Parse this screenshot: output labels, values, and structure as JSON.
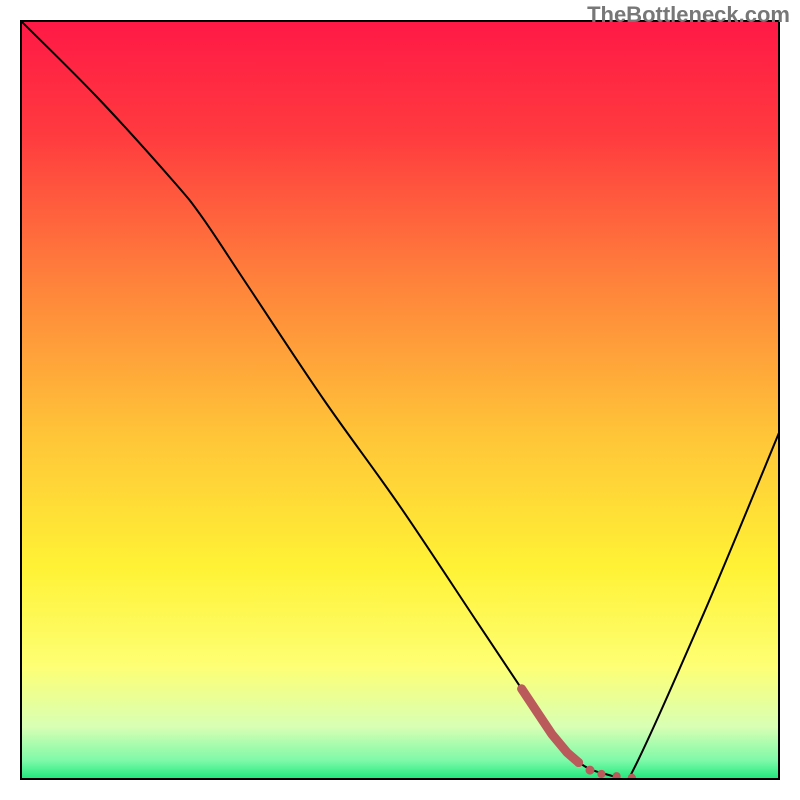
{
  "watermark": "TheBottleneck.com",
  "chart_data": {
    "type": "line",
    "title": "",
    "xlabel": "",
    "ylabel": "",
    "xlim": [
      0,
      100
    ],
    "ylim": [
      0,
      100
    ],
    "grid": false,
    "series": [
      {
        "name": "bottleneck-curve",
        "x": [
          0,
          10,
          20,
          24,
          30,
          40,
          50,
          60,
          66,
          70,
          74,
          78,
          80,
          90,
          100
        ],
        "y": [
          100,
          90,
          79,
          74,
          65,
          50,
          36,
          21,
          12,
          6,
          2,
          0.5,
          0,
          22,
          46
        ],
        "color": "#000000",
        "stroke_width": 2
      }
    ],
    "highlight_segment": {
      "name": "dotted-highlight",
      "color": "#bb5a5a",
      "stroke_width": 9,
      "points_x": [
        66,
        68,
        70,
        72,
        73.5,
        75,
        76.5,
        78.5,
        80.5
      ],
      "points_y": [
        12,
        9,
        6,
        3.6,
        2.3,
        1.3,
        0.8,
        0.5,
        0.3
      ]
    },
    "background_gradient": {
      "stops": [
        {
          "offset": 0.0,
          "color": "#ff1846"
        },
        {
          "offset": 0.15,
          "color": "#ff3a3f"
        },
        {
          "offset": 0.35,
          "color": "#ff843b"
        },
        {
          "offset": 0.55,
          "color": "#ffc638"
        },
        {
          "offset": 0.72,
          "color": "#fff235"
        },
        {
          "offset": 0.85,
          "color": "#feff74"
        },
        {
          "offset": 0.93,
          "color": "#d8ffb4"
        },
        {
          "offset": 0.975,
          "color": "#7cf9a8"
        },
        {
          "offset": 1.0,
          "color": "#19e779"
        }
      ]
    }
  }
}
